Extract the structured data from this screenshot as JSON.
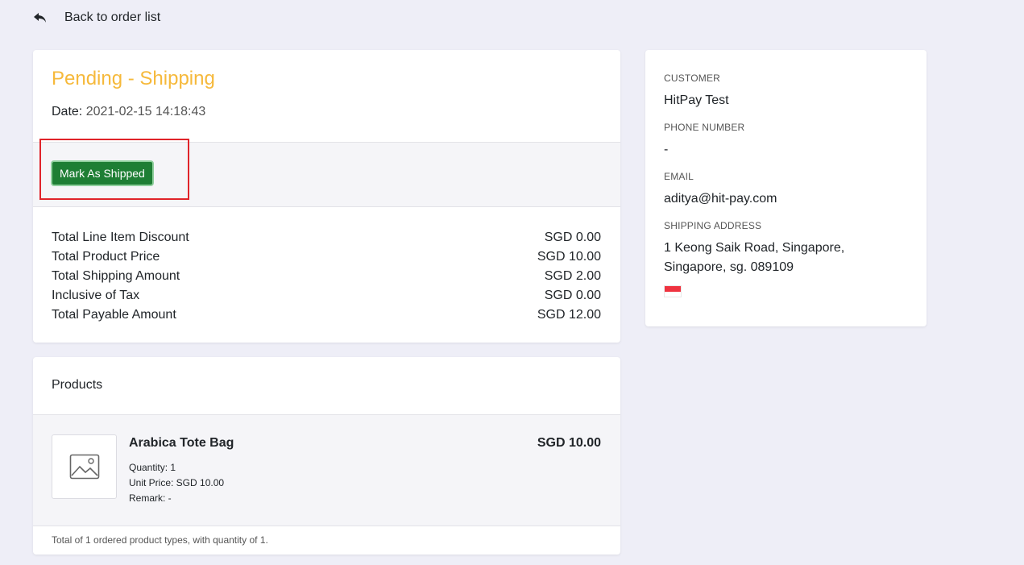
{
  "nav": {
    "back_label": "Back to order list"
  },
  "order": {
    "status": "Pending - Shipping",
    "date_label": "Date:",
    "date_value": "2021-02-15 14:18:43",
    "action_button": "Mark As Shipped",
    "totals": [
      {
        "label": "Total Line Item Discount",
        "value": "SGD 0.00"
      },
      {
        "label": "Total Product Price",
        "value": "SGD 10.00"
      },
      {
        "label": "Total Shipping Amount",
        "value": "SGD 2.00"
      },
      {
        "label": "Inclusive of Tax",
        "value": "SGD 0.00"
      },
      {
        "label": "Total Payable Amount",
        "value": "SGD 12.00"
      }
    ]
  },
  "products": {
    "heading": "Products",
    "items": [
      {
        "name": "Arabica Tote Bag",
        "price": "SGD 10.00",
        "quantity": "Quantity: 1",
        "unit_price": "Unit Price: SGD 10.00",
        "remark": "Remark: -"
      }
    ],
    "footer": "Total of 1 ordered product types, with quantity of 1."
  },
  "customer": {
    "customer_label": "CUSTOMER",
    "customer_value": "HitPay Test",
    "phone_label": "PHONE NUMBER",
    "phone_value": "-",
    "email_label": "EMAIL",
    "email_value": "aditya@hit-pay.com",
    "address_label": "SHIPPING ADDRESS",
    "address_value": "1 Keong Saik Road, Singapore, Singapore, sg. 089109",
    "flag_icon": "singapore-flag-icon"
  },
  "colors": {
    "status": "#f6b93b",
    "button": "#1e7e34",
    "highlight": "#e0242a",
    "background": "#eeeef7"
  }
}
